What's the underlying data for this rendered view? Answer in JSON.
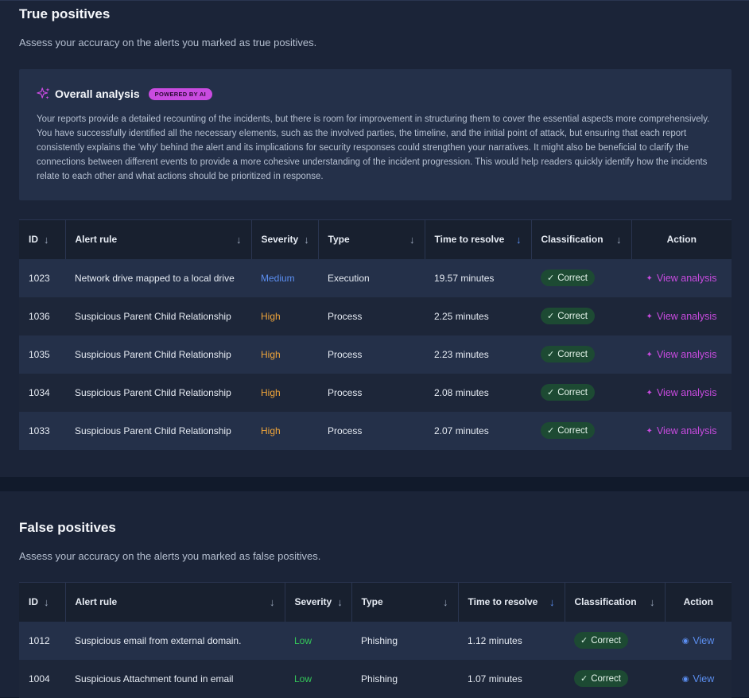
{
  "true_positives": {
    "title": "True positives",
    "description": "Assess your accuracy on the alerts you marked as true positives.",
    "analysis": {
      "title": "Overall analysis",
      "badge": "POWERED BY AI",
      "body": "Your reports provide a detailed recounting of the incidents, but there is room for improvement in structuring them to cover the essential aspects more comprehensively. You have successfully identified all the necessary elements, such as the involved parties, the timeline, and the initial point of attack, but ensuring that each report consistently explains the 'why' behind the alert and its implications for security responses could strengthen your narratives. It might also be beneficial to clarify the connections between different events to provide a more cohesive understanding of the incident progression. This would help readers quickly identify how the incidents relate to each other and what actions should be prioritized in response."
    },
    "columns": [
      "ID",
      "Alert rule",
      "Severity",
      "Type",
      "Time to resolve",
      "Classification",
      "Action"
    ],
    "rows": [
      {
        "id": "1023",
        "rule": "Network drive mapped to a local drive",
        "severity": "Medium",
        "type": "Execution",
        "time": "19.57 minutes",
        "classification": "Correct",
        "action": "View analysis"
      },
      {
        "id": "1036",
        "rule": "Suspicious Parent Child Relationship",
        "severity": "High",
        "type": "Process",
        "time": "2.25 minutes",
        "classification": "Correct",
        "action": "View analysis"
      },
      {
        "id": "1035",
        "rule": "Suspicious Parent Child Relationship",
        "severity": "High",
        "type": "Process",
        "time": "2.23 minutes",
        "classification": "Correct",
        "action": "View analysis"
      },
      {
        "id": "1034",
        "rule": "Suspicious Parent Child Relationship",
        "severity": "High",
        "type": "Process",
        "time": "2.08 minutes",
        "classification": "Correct",
        "action": "View analysis"
      },
      {
        "id": "1033",
        "rule": "Suspicious Parent Child Relationship",
        "severity": "High",
        "type": "Process",
        "time": "2.07 minutes",
        "classification": "Correct",
        "action": "View analysis"
      }
    ]
  },
  "false_positives": {
    "title": "False positives",
    "description": "Assess your accuracy on the alerts you marked as false positives.",
    "columns": [
      "ID",
      "Alert rule",
      "Severity",
      "Type",
      "Time to resolve",
      "Classification",
      "Action"
    ],
    "rows": [
      {
        "id": "1012",
        "rule": "Suspicious email from external domain.",
        "severity": "Low",
        "type": "Phishing",
        "time": "1.12 minutes",
        "classification": "Correct",
        "action": "View"
      },
      {
        "id": "1004",
        "rule": "Suspicious Attachment found in email",
        "severity": "Low",
        "type": "Phishing",
        "time": "1.07 minutes",
        "classification": "Correct",
        "action": "View"
      }
    ]
  },
  "colors": {
    "accent_purple": "#c94be0",
    "accent_blue": "#5b8ef0",
    "severity_high": "#f0a53a",
    "severity_low": "#34c759",
    "correct_badge": "#1d4a33"
  }
}
